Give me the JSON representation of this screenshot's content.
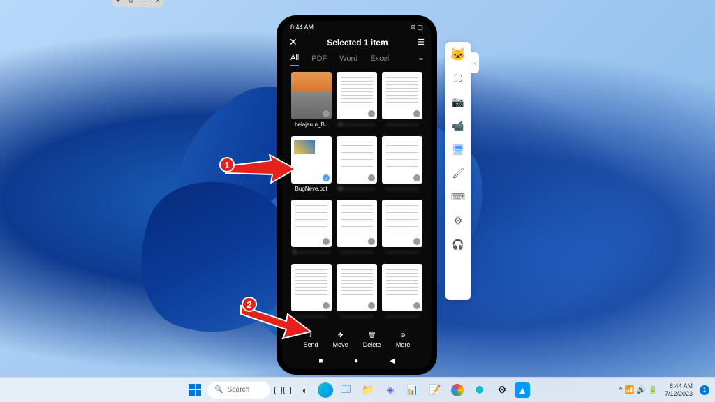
{
  "mirror_titlebar": {
    "pin": "✦",
    "settings": "⚙",
    "min": "—",
    "close": "✕"
  },
  "status": {
    "time": "8:44 AM",
    "icons": "✉ ▢"
  },
  "header": {
    "close": "✕",
    "title": "Selected 1 item",
    "filter": "☰"
  },
  "tabs": {
    "items": [
      "All",
      "PDF",
      "Word",
      "Excel"
    ],
    "active": 0,
    "menu": "≡"
  },
  "files": [
    {
      "label": "belajarun_Bu",
      "blur": false,
      "type": "photo"
    },
    {
      "label": "H——————",
      "blur": true,
      "type": "doc"
    },
    {
      "label": "——————",
      "blur": true,
      "type": "doc"
    },
    {
      "label": "BugNeve.pdf",
      "blur": false,
      "type": "color",
      "selected": true
    },
    {
      "label": "M——————",
      "blur": true,
      "type": "doc"
    },
    {
      "label": "——————",
      "blur": true,
      "type": "doc"
    },
    {
      "label": "S——————",
      "blur": true,
      "type": "doc"
    },
    {
      "label": "——————",
      "blur": true,
      "type": "doc"
    },
    {
      "label": "——————",
      "blur": true,
      "type": "doc"
    },
    {
      "label": "——————",
      "blur": true,
      "type": "doc"
    },
    {
      "label": "——————",
      "blur": true,
      "type": "doc"
    },
    {
      "label": "——————",
      "blur": true,
      "type": "doc"
    }
  ],
  "actions": [
    {
      "label": "Send",
      "icon": "⇪"
    },
    {
      "label": "Move",
      "icon": "✥"
    },
    {
      "label": "Delete",
      "icon": "🗑"
    },
    {
      "label": "More",
      "icon": "⊝"
    }
  ],
  "nav": {
    "recent": "■",
    "home": "●",
    "back": "◀"
  },
  "side_tools": [
    {
      "name": "cat-icon",
      "glyph": "🐱",
      "cls": "cat"
    },
    {
      "name": "fullscreen-icon",
      "glyph": "⛶"
    },
    {
      "name": "camera-icon",
      "glyph": "📷"
    },
    {
      "name": "record-icon",
      "glyph": "📹"
    },
    {
      "name": "cast-icon",
      "glyph": "🖥",
      "active": true
    },
    {
      "name": "brush-icon",
      "glyph": "🖌"
    },
    {
      "name": "keyboard-icon",
      "glyph": "⌨"
    },
    {
      "name": "settings-icon",
      "glyph": "⚙"
    },
    {
      "name": "support-icon",
      "glyph": "🎧"
    }
  ],
  "annotations": {
    "badge1": "1",
    "badge2": "2"
  },
  "taskbar": {
    "search": "Search",
    "time": "8:44 AM",
    "date": "7/12/2023",
    "notif": "1",
    "tray": "^  📶 🔊 🔋"
  }
}
